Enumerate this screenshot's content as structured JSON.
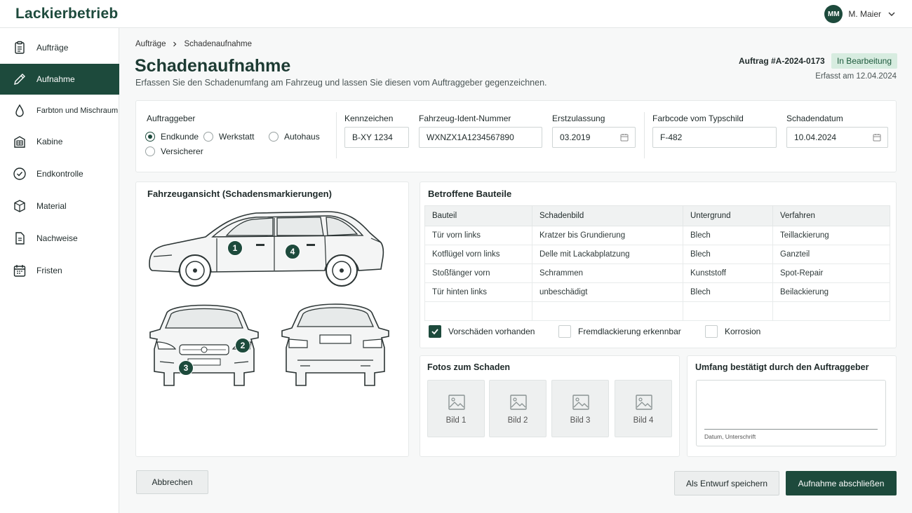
{
  "app": {
    "brand": "Lackierbetrieb"
  },
  "user": {
    "initials": "MM",
    "name": "M. Maier"
  },
  "sidebar": {
    "items": [
      {
        "label": "Aufträge",
        "icon": "clipboard-icon",
        "active": false
      },
      {
        "label": "Aufnahme",
        "icon": "pencil-icon",
        "active": true
      },
      {
        "label": "Farbton und Mischraum",
        "icon": "drop-icon",
        "active": false
      },
      {
        "label": "Kabine",
        "icon": "building-icon",
        "active": false
      },
      {
        "label": "Endkontrolle",
        "icon": "check-circle-icon",
        "active": false
      },
      {
        "label": "Material",
        "icon": "box-icon",
        "active": false
      },
      {
        "label": "Nachweise",
        "icon": "document-icon",
        "active": false
      },
      {
        "label": "Fristen",
        "icon": "calendar-icon",
        "active": false
      }
    ]
  },
  "breadcrumb": {
    "parent": "Aufträge",
    "current": "Schadenaufnahme"
  },
  "header": {
    "title": "Schadenaufnahme",
    "subtitle": "Erfassen Sie den Schadenumfang am Fahrzeug und lassen Sie diesen vom Auftraggeber gegenzeichnen.",
    "order_number": "Auftrag #A-2024-0173",
    "status": "In Bearbeitung",
    "recorded": "Erfasst am 12.04.2024"
  },
  "form": {
    "client_label": "Auftraggeber",
    "client_options": [
      "Endkunde",
      "Werkstatt",
      "Autohaus",
      "Versicherer"
    ],
    "client_selected": "Endkunde",
    "plate": {
      "label": "Kennzeichen",
      "value": "B-XY 1234"
    },
    "vin": {
      "label": "Fahrzeug-Ident-Nummer",
      "value": "WXNZX1A1234567890"
    },
    "first_reg": {
      "label": "Erstzulassung",
      "value": "03.2019"
    },
    "color_code": {
      "label": "Farbcode vom Typschild",
      "value": "F-482"
    },
    "damage_date": {
      "label": "Schadendatum",
      "value": "10.04.2024"
    }
  },
  "vehicle_view": {
    "title": "Fahrzeugansicht (Schadensmarkierungen)",
    "markers": [
      "1",
      "4",
      "2",
      "3"
    ]
  },
  "parts": {
    "title": "Betroffene Bauteile",
    "columns": [
      "Bauteil",
      "Schadenbild",
      "Untergrund",
      "Verfahren"
    ],
    "rows": [
      [
        "Tür vorn links",
        "Kratzer bis Grundierung",
        "Blech",
        "Teillackierung"
      ],
      [
        "Kotflügel vorn links",
        "Delle mit Lackabplatzung",
        "Blech",
        "Ganzteil"
      ],
      [
        "Stoßfänger vorn",
        "Schrammen",
        "Kunststoff",
        "Spot-Repair"
      ],
      [
        "Tür hinten links",
        "unbeschädigt",
        "Blech",
        "Beilackierung"
      ]
    ],
    "checks": [
      {
        "label": "Vorschäden vorhanden",
        "checked": true
      },
      {
        "label": "Fremdlackierung erkennbar",
        "checked": false
      },
      {
        "label": "Korrosion",
        "checked": false
      }
    ]
  },
  "photos": {
    "title": "Fotos zum Schaden",
    "items": [
      "Bild 1",
      "Bild 2",
      "Bild 3",
      "Bild 4"
    ]
  },
  "signature": {
    "title": "Umfang bestätigt durch den Auftraggeber",
    "line_label": "Datum, Unterschrift"
  },
  "actions": {
    "cancel": "Abbrechen",
    "draft": "Als Entwurf speichern",
    "finish": "Aufnahme abschließen"
  },
  "colors": {
    "accent": "#1d4a3c",
    "badge_bg": "#d7ece0"
  }
}
